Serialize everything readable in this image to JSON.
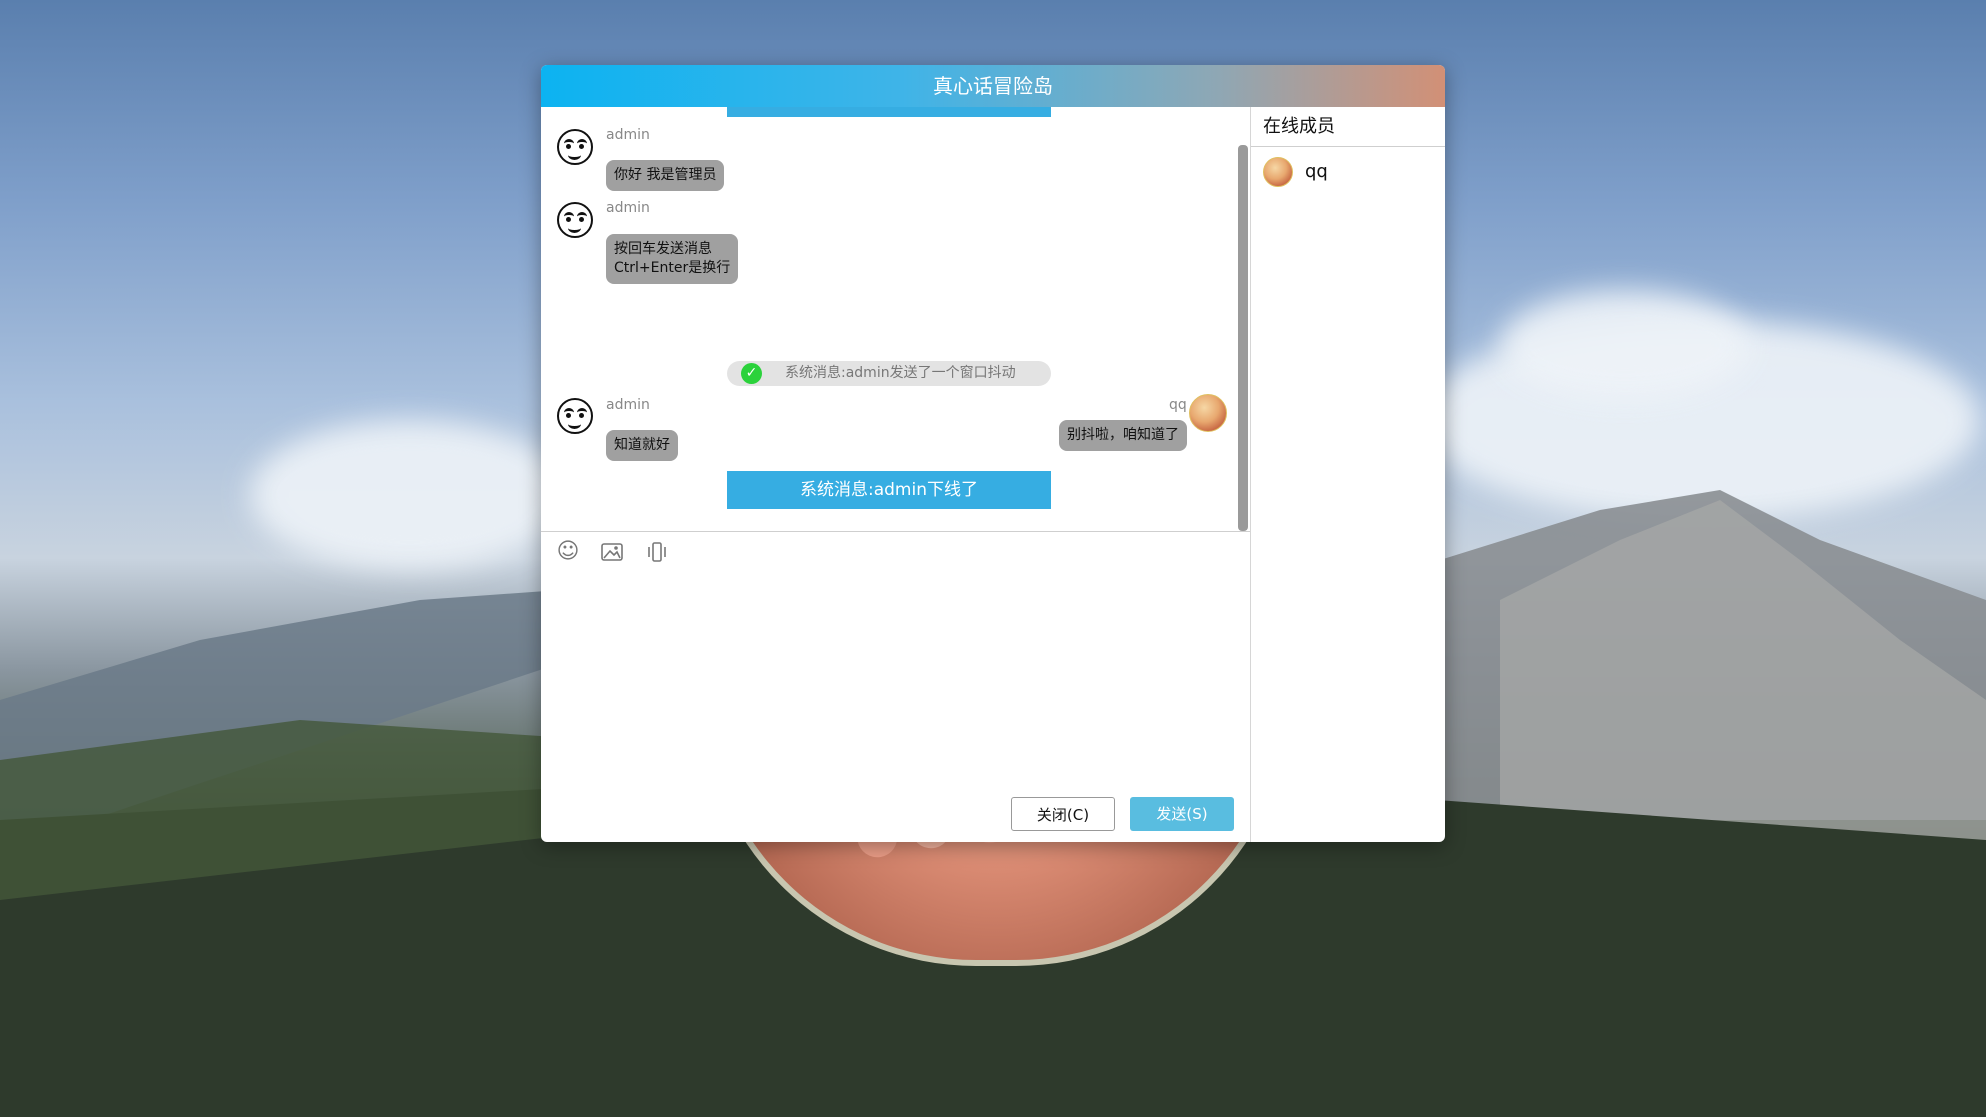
{
  "window": {
    "title": "真心话冒险岛"
  },
  "messages": {
    "items": [
      {
        "sender": "admin",
        "text": "你好 我是管理员"
      },
      {
        "sender": "admin",
        "text_line1": "按回车发送消息",
        "text_line2": "Ctrl+Enter是换行"
      },
      {
        "system_notice": "系统消息:admin发送了一个窗口抖动"
      },
      {
        "sender": "qq",
        "text": "别抖啦，咱知道了"
      },
      {
        "sender": "admin",
        "text": "知道就好"
      },
      {
        "system_banner": "系统消息:admin下线了"
      }
    ]
  },
  "toolbar": {
    "icons": [
      "smiley-icon",
      "image-icon",
      "shake-icon"
    ]
  },
  "buttons": {
    "close_label": "关闭(C)",
    "send_label": "发送(S)"
  },
  "members": {
    "header": "在线成员",
    "list": [
      {
        "name": "qq"
      }
    ]
  },
  "colors": {
    "accent": "#36ade2",
    "send_button": "#59bde0",
    "bubble": "#a0a0a0"
  }
}
